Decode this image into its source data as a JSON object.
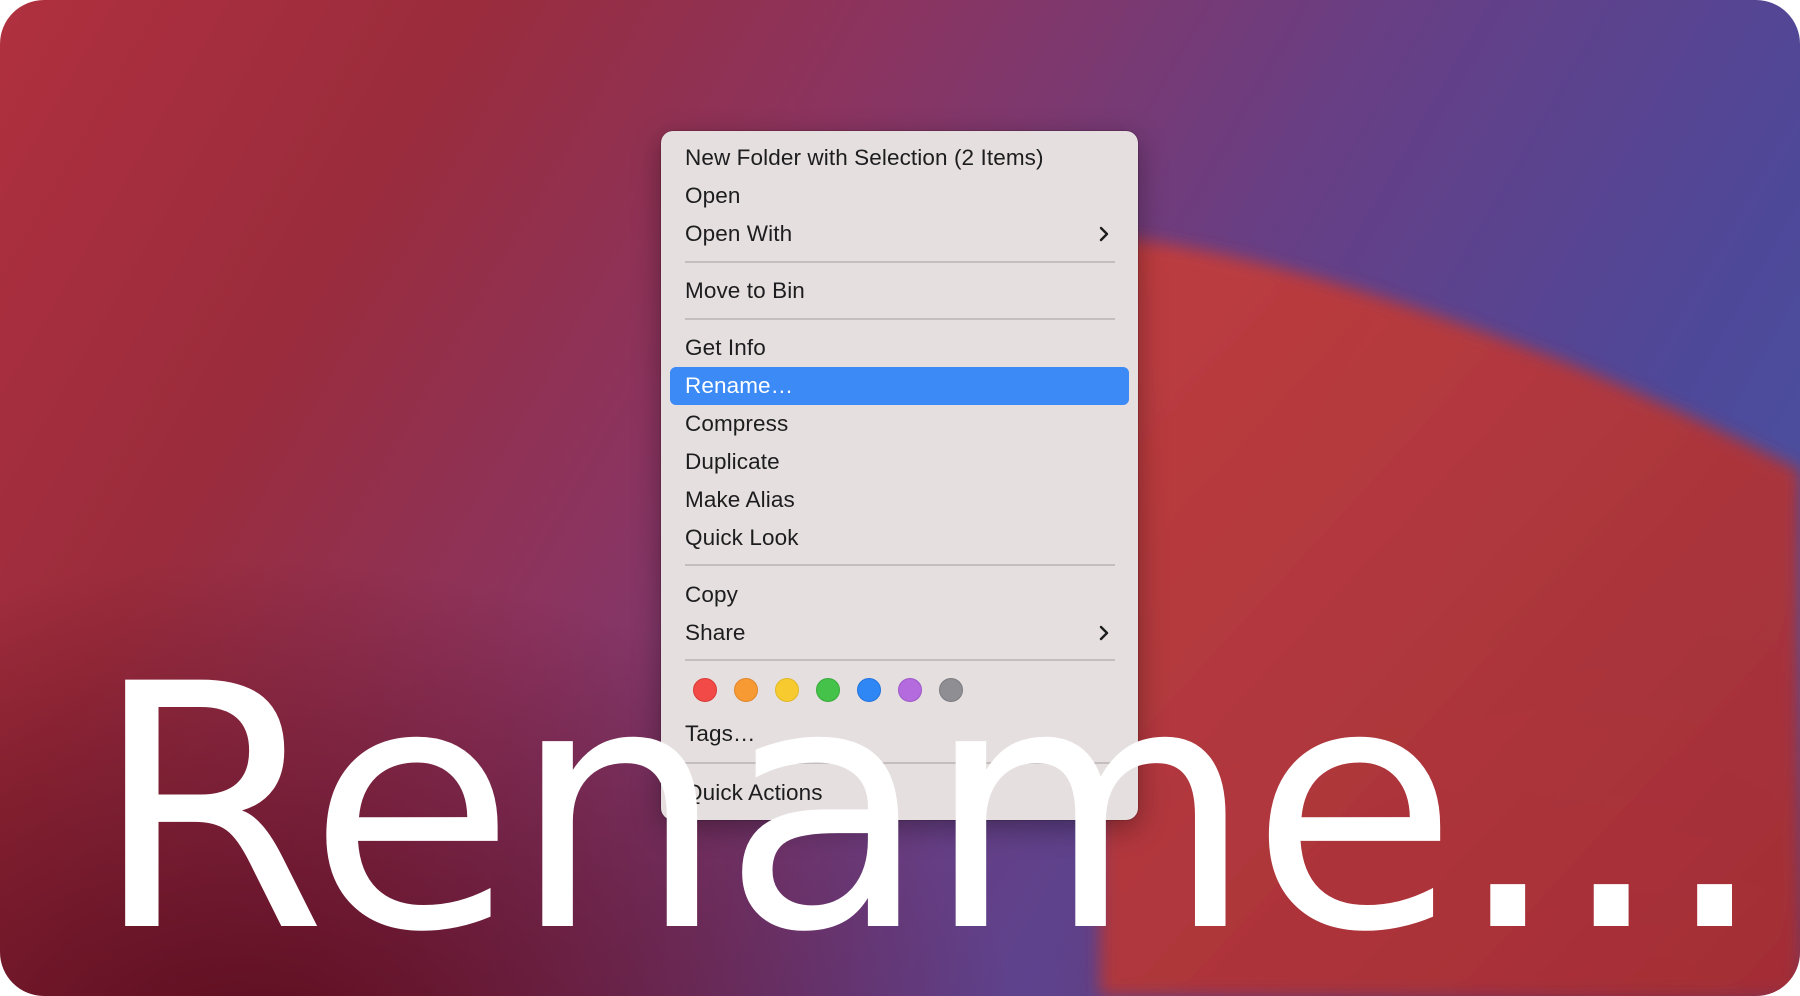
{
  "context_menu": {
    "items": [
      {
        "label": "New Folder with Selection (2 Items)"
      },
      {
        "label": "Open"
      },
      {
        "label": "Open With"
      },
      {
        "label": "Move to Bin"
      },
      {
        "label": "Get Info"
      },
      {
        "label": "Rename…"
      },
      {
        "label": "Compress"
      },
      {
        "label": "Duplicate"
      },
      {
        "label": "Make Alias"
      },
      {
        "label": "Quick Look"
      },
      {
        "label": "Copy"
      },
      {
        "label": "Share"
      },
      {
        "label": "Tags…"
      },
      {
        "label": "Quick Actions"
      }
    ],
    "selected_item": "Rename…",
    "tag_colors": [
      {
        "name": "red",
        "color": "#f24a47"
      },
      {
        "name": "orange",
        "color": "#f79a34"
      },
      {
        "name": "yellow",
        "color": "#f7cb2f"
      },
      {
        "name": "green",
        "color": "#44c249"
      },
      {
        "name": "blue",
        "color": "#2f86f5"
      },
      {
        "name": "purple",
        "color": "#b36bde"
      },
      {
        "name": "gray",
        "color": "#8f8f93"
      }
    ]
  },
  "overlay_caption": "Rename...",
  "colors": {
    "selection": "#3b8af6",
    "menu_background": "#e5dfdf"
  }
}
